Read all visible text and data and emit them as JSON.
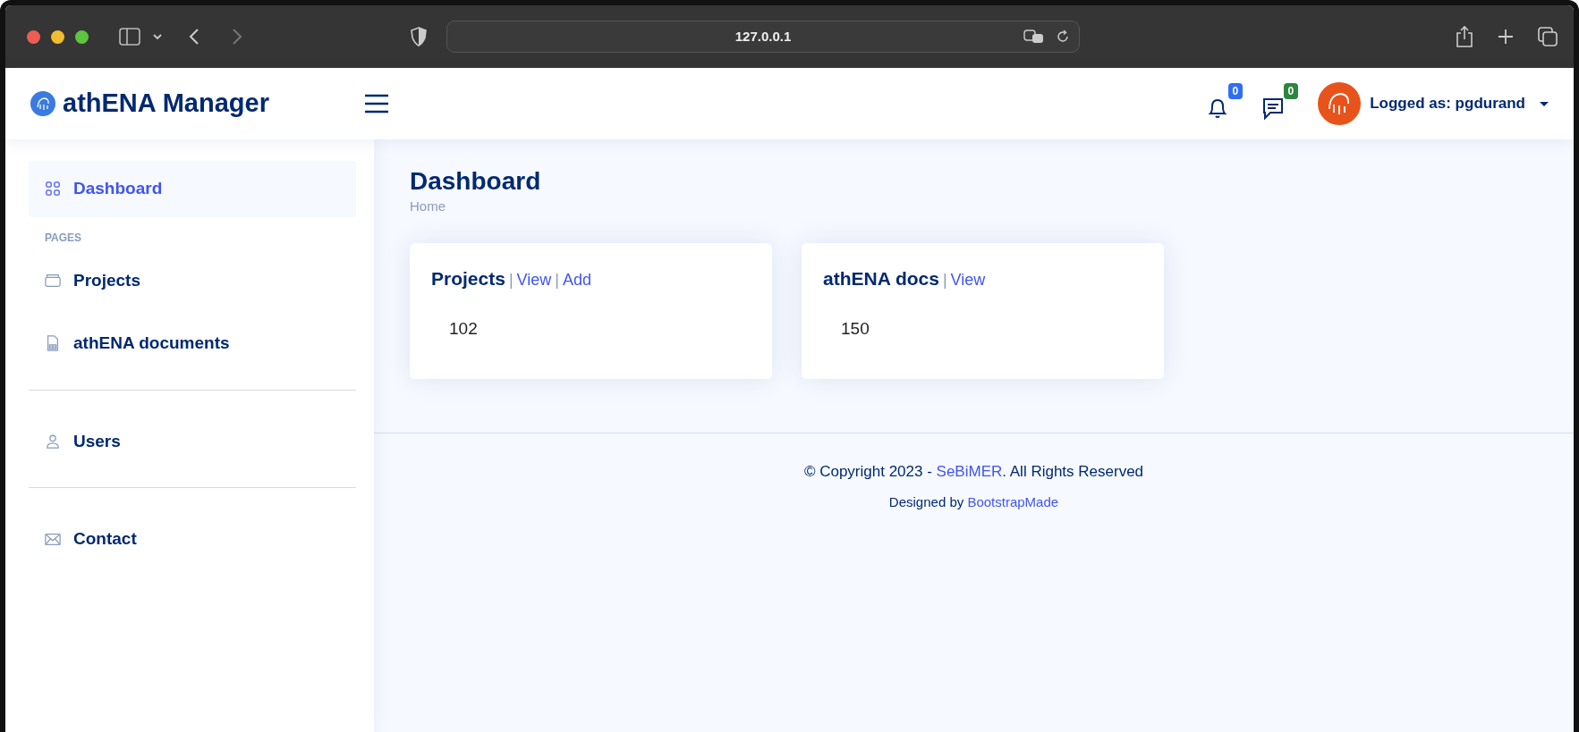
{
  "browser": {
    "url": "127.0.0.1"
  },
  "header": {
    "brand": "athENA Manager",
    "indicators": [
      {
        "count": "0",
        "color": "#2f6df6"
      },
      {
        "count": "0",
        "color": "#2e8540"
      }
    ],
    "user": "Logged as: pgdurand"
  },
  "sidebar": {
    "items": [
      {
        "kind": "link",
        "label": "Dashboard",
        "selected": true
      },
      {
        "kind": "heading",
        "label": "PAGES"
      },
      {
        "kind": "link",
        "label": "Projects",
        "selected": false
      },
      {
        "kind": "link",
        "label": "athENA documents",
        "selected": false
      },
      {
        "kind": "divider"
      },
      {
        "kind": "link",
        "label": "Users",
        "selected": false
      },
      {
        "kind": "divider"
      },
      {
        "kind": "link",
        "label": "Contact",
        "selected": false
      }
    ]
  },
  "page": {
    "title": "Dashboard",
    "breadcrumb": "Home"
  },
  "cards": [
    {
      "title": "Projects",
      "links": [
        {
          "separator": "|",
          "label": "View"
        },
        {
          "separator": "|",
          "label": "Add"
        }
      ],
      "value": "102"
    },
    {
      "title": "athENA docs",
      "links": [
        {
          "separator": "|",
          "label": "View"
        }
      ],
      "value": "150"
    }
  ],
  "footer": {
    "copyright": {
      "before": "© Copyright 2023 - ",
      "link": "SeBiMER",
      "after": ". All Rights Reserved"
    },
    "credit": {
      "before": "Designed by ",
      "link": "BootstrapMade"
    }
  }
}
